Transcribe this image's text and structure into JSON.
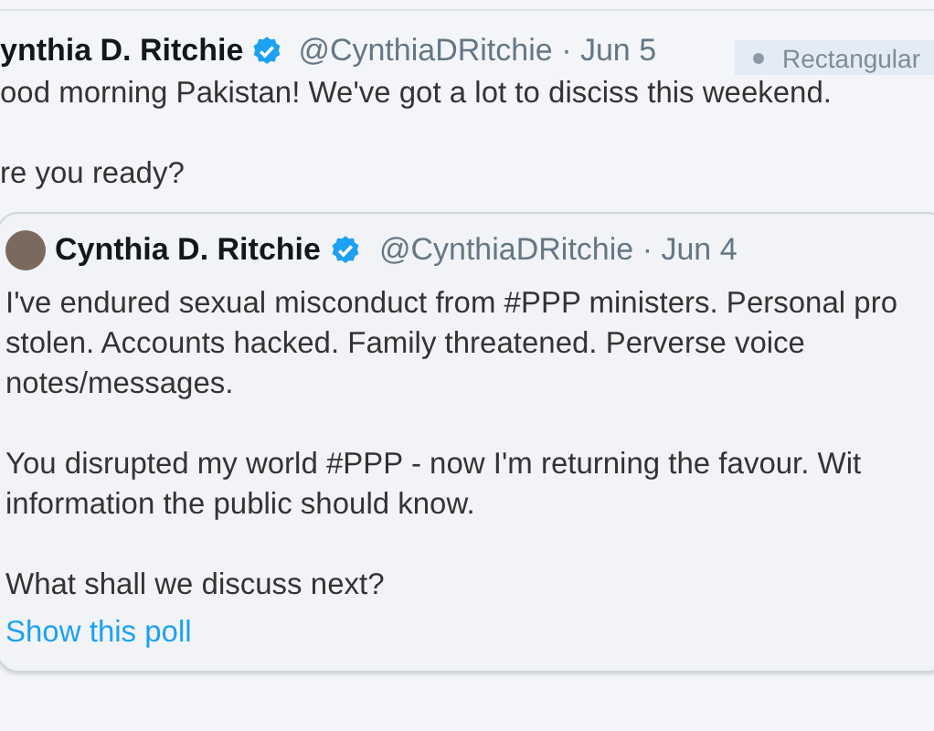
{
  "tweet": {
    "name": "ynthia D. Ritchie",
    "verified": true,
    "handle": "@CynthiaDRitchie",
    "date": "· Jun 5",
    "paragraphs": [
      "ood morning Pakistan! We've got a lot to disciss this weekend.",
      "re you ready?"
    ]
  },
  "overlay_tag": {
    "label": "Rectangular"
  },
  "quoted_tweet": {
    "name": "Cynthia D. Ritchie",
    "verified": true,
    "handle": "@CynthiaDRitchie",
    "date": "· Jun 4",
    "paragraphs": [
      "I've endured sexual misconduct from #PPP ministers. Personal pro\nstolen. Accounts hacked. Family threatened. Perverse voice\nnotes/messages.",
      "You disrupted my world #PPP - now I'm returning the favour. Wit\ninformation the public should know.",
      "What shall we discuss next?"
    ],
    "link": "Show this poll"
  }
}
